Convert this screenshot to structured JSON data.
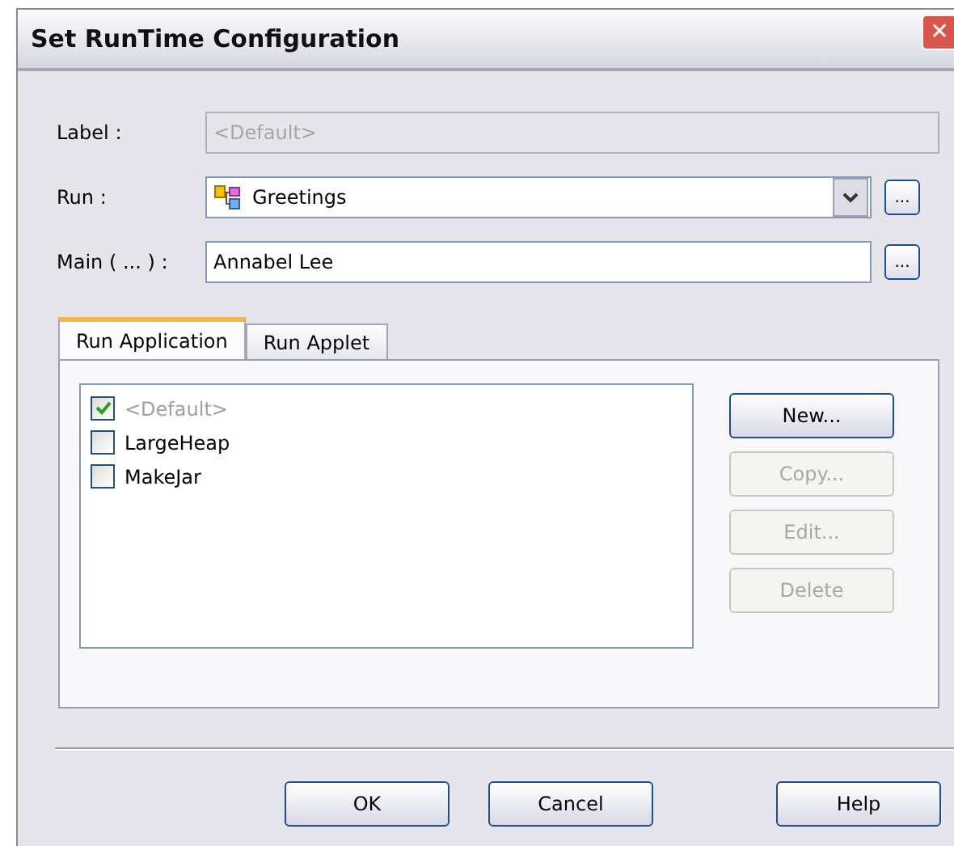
{
  "window": {
    "title": "Set RunTime Configuration",
    "close": "✕"
  },
  "fields": [
    {
      "kind": "readonly",
      "label": "Label :",
      "value": "<Default>"
    },
    {
      "kind": "combo",
      "label": "Run :",
      "value": "Greetings",
      "browse": "..."
    },
    {
      "kind": "text",
      "label": "Main ( ... ) :",
      "value": "Annabel Lee",
      "browse": "..."
    }
  ],
  "tabs": [
    {
      "label": "Run Application",
      "selected": true
    },
    {
      "label": "Run Applet",
      "selected": false
    }
  ],
  "options": [
    {
      "label": "<Default>",
      "checked": true,
      "disabled": true
    },
    {
      "label": "LargeHeap",
      "checked": false,
      "disabled": false
    },
    {
      "label": "MakeJar",
      "checked": false,
      "disabled": false
    }
  ],
  "list_buttons": [
    {
      "label": "New...",
      "disabled": false
    },
    {
      "label": "Copy...",
      "disabled": true
    },
    {
      "label": "Edit...",
      "disabled": true
    },
    {
      "label": "Delete",
      "disabled": true
    }
  ],
  "buttons": [
    "OK",
    "Cancel",
    "Help"
  ]
}
